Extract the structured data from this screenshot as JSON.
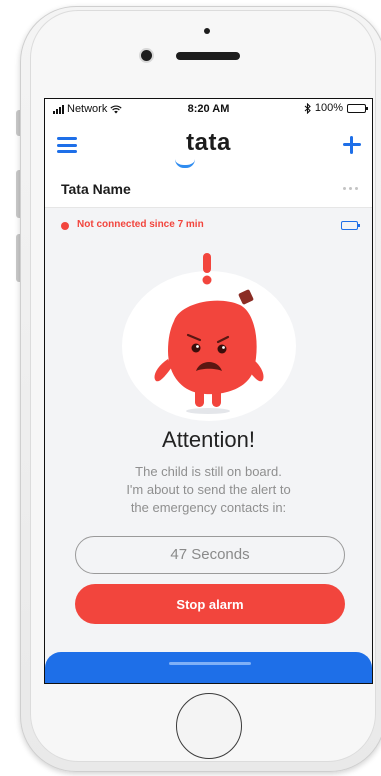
{
  "status_bar": {
    "carrier": "Network",
    "time": "8:20 AM",
    "battery_percent": "100%"
  },
  "nav": {
    "logo_text": "tata",
    "menu_icon": "hamburger-menu-icon",
    "add_icon": "plus-icon"
  },
  "device": {
    "name": "Tata Name",
    "more_icon": "more-dots-icon",
    "connection_status": "Not connected since 7 min",
    "battery_level": 1.0
  },
  "alert": {
    "title": "Attention!",
    "message_lines": [
      "The child is still on board.",
      "I'm about to send the alert to",
      "the emergency contacts in:"
    ],
    "countdown": "47 Seconds",
    "stop_label": "Stop alarm"
  },
  "colors": {
    "accent_blue": "#1e6fe8",
    "alert_red": "#f2453d",
    "screen_bg": "#f3f4f6",
    "mascot_red": "#f2453d"
  }
}
